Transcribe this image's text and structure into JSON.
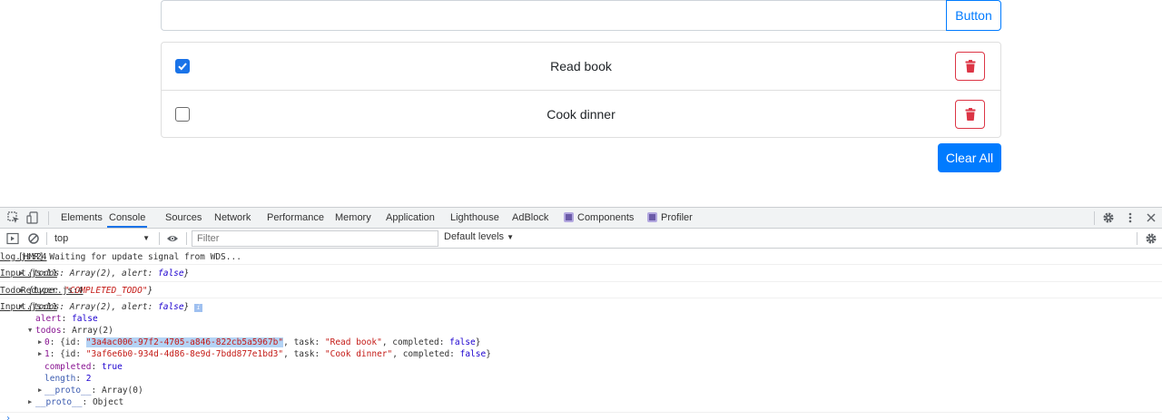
{
  "app": {
    "input_value": "",
    "add_button_label": "Button",
    "todos": [
      {
        "task": "Read book",
        "completed": true
      },
      {
        "task": "Cook dinner",
        "completed": false
      }
    ],
    "clear_all_label": "Clear All"
  },
  "devtools": {
    "tabs": [
      "Elements",
      "Console",
      "Sources",
      "Network",
      "Performance",
      "Memory",
      "Application",
      "Lighthouse",
      "AdBlock",
      "Components",
      "Profiler"
    ],
    "active_tab": "Console",
    "context": "top",
    "filter_placeholder": "Filter",
    "levels_label": "Default levels",
    "accent": "#1a73e8",
    "console": {
      "hmr_message": "[HMR] Waiting for update signal from WDS...",
      "hmr_source": "log.js:24",
      "log1_source": "Input.js:11",
      "log2_source": "TodoReducer.js:4",
      "log3_source": "Input.js:11",
      "action_type": "\"COMPLETED_TODO\"",
      "alert_value": "false",
      "todos_summary": "Array(2)",
      "todo0_id": "\"3a4ac006-97f2-4705-a846-822cb5a5967b\"",
      "todo0_task": "\"Read book\"",
      "todo0_completed": "false",
      "todo1_id": "\"3af6e6b0-934d-4d86-8e9d-7bdd877e1bd3\"",
      "todo1_task": "\"Cook dinner\"",
      "todo1_completed": "false",
      "completed_value": "true",
      "length_value": "2",
      "todos_proto": "Array(0)",
      "obj_proto": "Object"
    }
  }
}
